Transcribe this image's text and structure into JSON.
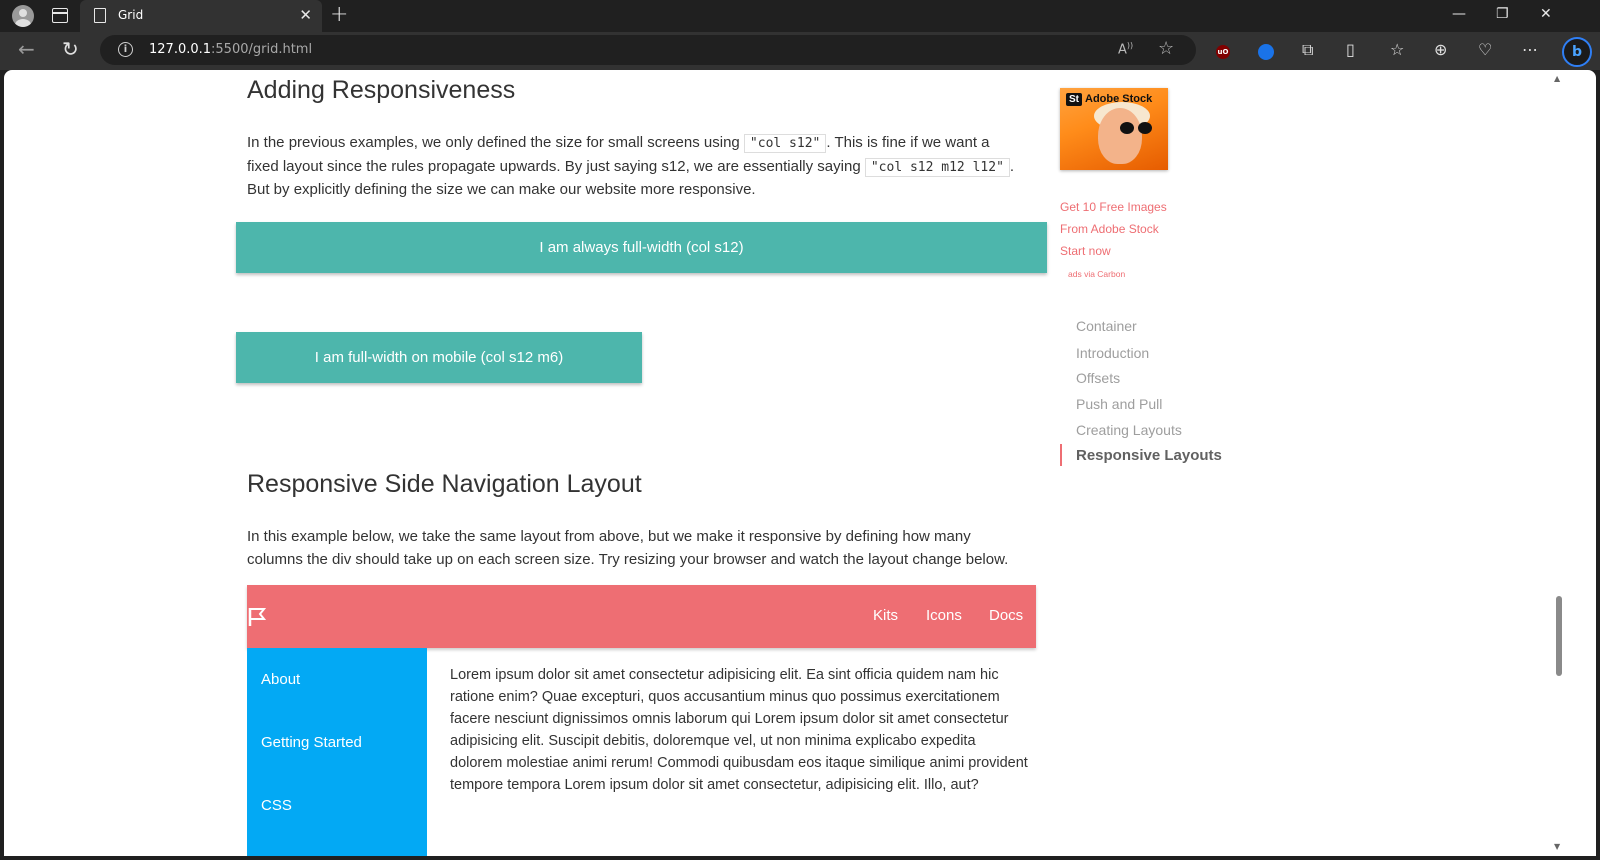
{
  "browser": {
    "tab_title": "Grid",
    "url_host": "127.0.0.1",
    "url_path": ":5500/grid.html",
    "read_aloud_label": "A̅"
  },
  "content": {
    "heading1": "Adding Responsiveness",
    "para1_a": "In the previous examples, we only defined the size for small screens using ",
    "code1": "\"col s12\"",
    "para1_b": ". This is fine if we want a fixed layout since the rules propagate upwards. By just saying s12, we are essentially saying ",
    "code2": "\"col s12 m12 l12\"",
    "para1_c": ". But by explicitly defining the size we can make our website more responsive.",
    "box_full": "I am always full-width (col s12)",
    "box_mobile": "I am full-width on mobile (col s12 m6)",
    "heading2": "Responsive Side Navigation Layout",
    "para2": "In this example below, we take the same layout from above, but we make it responsive by defining how many columns the div should take up on each screen size. Try resizing your browser and watch the layout change below.",
    "demo_nav_links": [
      "Kits",
      "Icons",
      "Docs"
    ],
    "demo_side_items": [
      "About",
      "Getting Started",
      "CSS"
    ],
    "lorem": "Lorem ipsum dolor sit amet consectetur adipisicing elit. Ea sint officia quidem nam hic ratione enim? Quae excepturi, quos accusantium minus quo possimus exercitationem facere nesciunt dignissimos omnis laborum qui Lorem ipsum dolor sit amet consectetur adipisicing elit. Suscipit debitis, doloremque vel, ut non minima explicabo expedita dolorem molestiae animi rerum! Commodi quibusdam eos itaque similique animi provident tempore tempora Lorem ipsum dolor sit amet consectetur, adipisicing elit. Illo, aut?"
  },
  "ad": {
    "badge_st": "St",
    "badge_text": "Adobe Stock",
    "line1": "Get 10 Free Images",
    "line2": "From Adobe Stock",
    "line3": "Start now",
    "via": "ads via Carbon"
  },
  "toc": {
    "items": [
      "Container",
      "Introduction",
      "Offsets",
      "Push and Pull",
      "Creating Layouts",
      "Responsive Layouts"
    ],
    "active": "Responsive Layouts"
  },
  "colors": {
    "teal": "#4db6ac",
    "red_nav": "#ee6e73",
    "blue_side": "#03a9f4"
  }
}
